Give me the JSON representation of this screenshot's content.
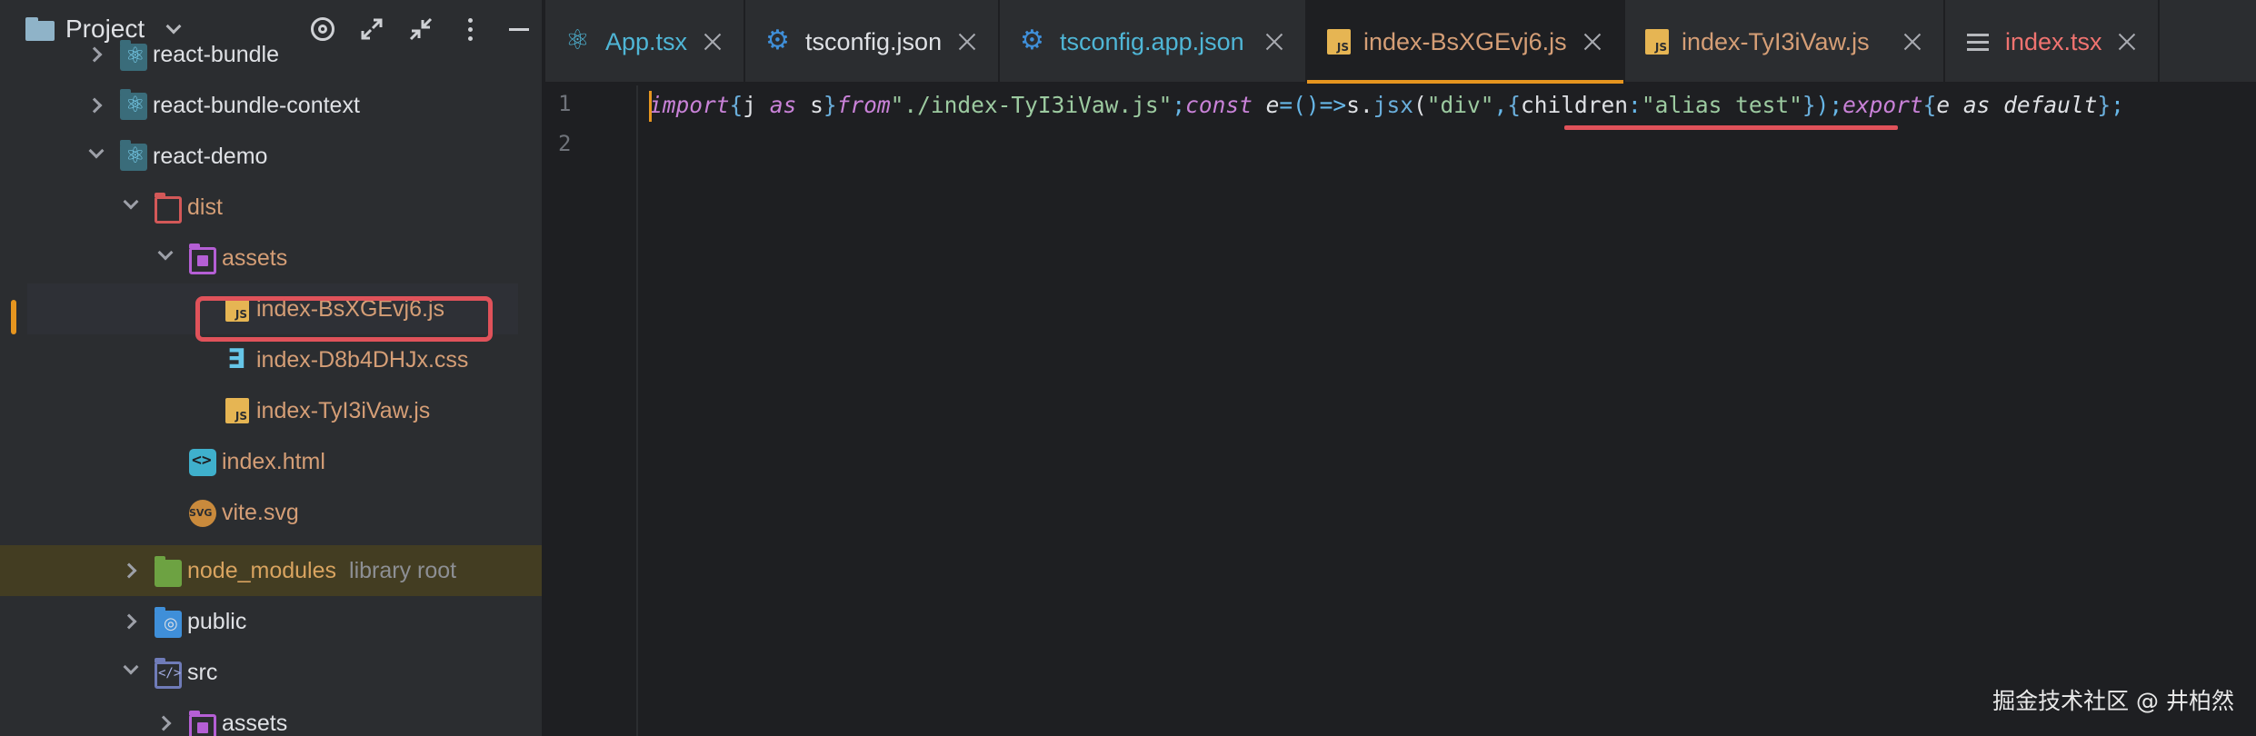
{
  "project_panel": {
    "title": "Project",
    "tree": [
      {
        "label": "react-bundle",
        "icon": "react-folder-icon",
        "expanded": false
      },
      {
        "label": "react-bundle-context",
        "icon": "react-folder-icon",
        "expanded": false
      },
      {
        "label": "react-demo",
        "icon": "react-folder-icon",
        "expanded": true
      },
      {
        "label": "dist",
        "icon": "folder-icon",
        "expanded": true
      },
      {
        "label": "assets",
        "icon": "folder-icon",
        "expanded": true
      },
      {
        "label": "index-BsXGEvj6.js",
        "icon": "js-file-icon",
        "selected": true
      },
      {
        "label": "index-D8b4DHJx.css",
        "icon": "css-file-icon"
      },
      {
        "label": "index-TyI3iVaw.js",
        "icon": "js-file-icon"
      },
      {
        "label": "index.html",
        "icon": "html-file-icon"
      },
      {
        "label": "vite.svg",
        "icon": "svg-file-icon"
      },
      {
        "label": "node_modules",
        "sublabel": "library root",
        "icon": "node-folder-icon",
        "expanded": false
      },
      {
        "label": "public",
        "icon": "web-folder-icon",
        "expanded": false
      },
      {
        "label": "src",
        "icon": "source-folder-icon",
        "expanded": true
      },
      {
        "label": "assets",
        "icon": "folder-icon",
        "expanded": false
      }
    ]
  },
  "tabs": [
    {
      "label": "App.tsx",
      "icon": "react-icon",
      "active": false
    },
    {
      "label": "tsconfig.json",
      "icon": "gear-icon",
      "active": false
    },
    {
      "label": "tsconfig.app.json",
      "icon": "gear-icon",
      "active": false
    },
    {
      "label": "index-BsXGEvj6.js",
      "icon": "js-file-icon",
      "active": true
    },
    {
      "label": "index-TyI3iVaw.js",
      "icon": "js-file-icon",
      "active": false
    },
    {
      "label": "index.tsx",
      "icon": "structure-icon",
      "active": false
    }
  ],
  "editor": {
    "line_numbers": [
      "1",
      "2"
    ],
    "tokens": {
      "import_kw": "import",
      "lbrace1": "{",
      "j": "j ",
      "as1": "as",
      "s1": " s",
      "rbrace1": "}",
      "from_kw": "from",
      "path": "\"./index-TyI3iVaw.js\"",
      "semi1": ";",
      "const_kw": "const",
      "e1": " e",
      "assign": "=()=>",
      "s2": "s.",
      "jsx": "jsx",
      "lparen": "(",
      "div": "\"div\"",
      "comma": ",",
      "lbrace2": "{",
      "children": "children",
      "colon": ":",
      "alias": "\"alias test\"",
      "rbrace2": "}",
      "rparen_semi": ");",
      "export_kw": "export",
      "lbrace3": "{",
      "e_as_default": "e as default",
      "rbrace3": "}",
      "semi2": ";"
    }
  },
  "watermark": "掘金技术社区 @ 井柏然",
  "colors": {
    "accent": "#e6951f",
    "highlight": "#e0525a"
  }
}
